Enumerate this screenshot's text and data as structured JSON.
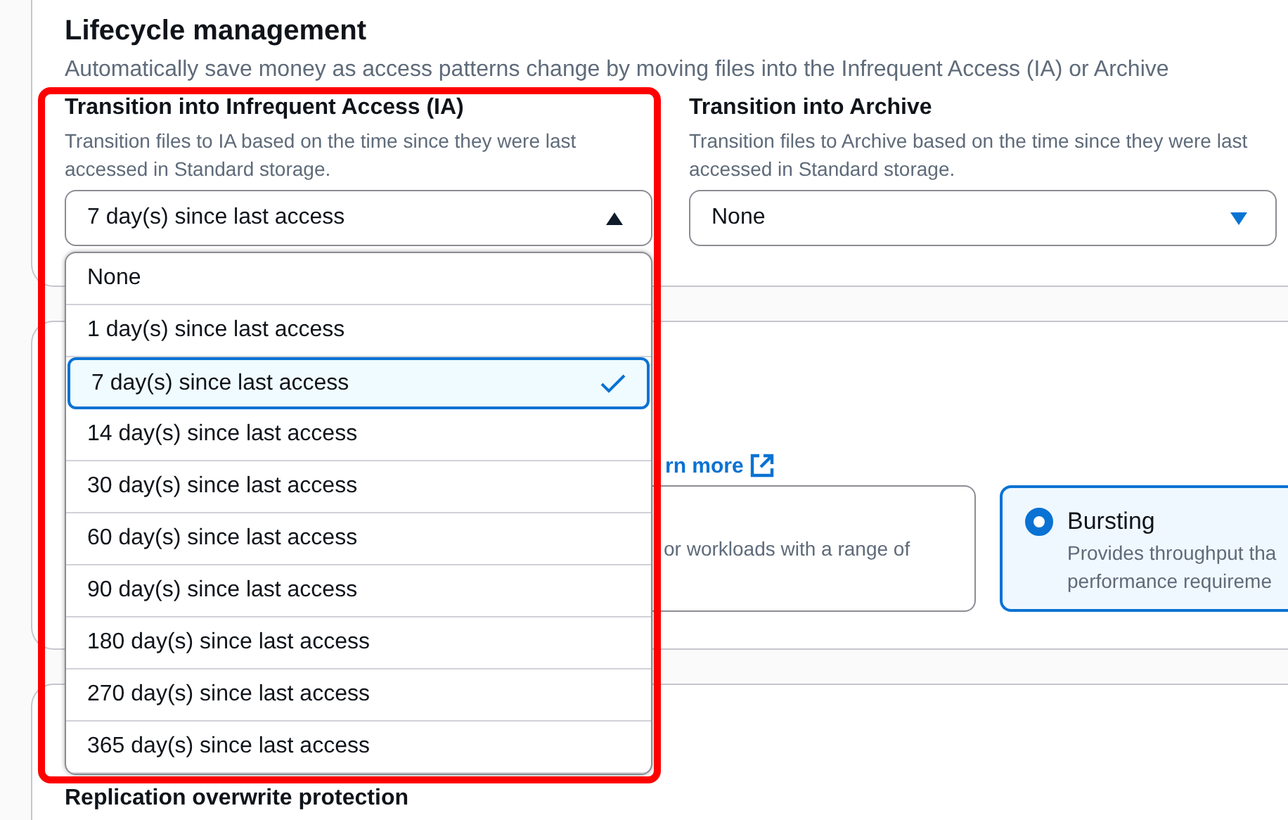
{
  "section": {
    "title": "Lifecycle management",
    "description": "Automatically save money as access patterns change by moving files into the Infrequent Access (IA) or Archive"
  },
  "fields": [
    {
      "label": "Transition into Infrequent Access (IA)",
      "description": "Transition files to IA based on the time since they were last accessed in Standard storage.",
      "value": "7 day(s) since last access",
      "expanded": true
    },
    {
      "label": "Transition into Archive",
      "description": "Transition files to Archive based on the time since they were last accessed in Standard storage.",
      "value": "None",
      "expanded": false
    }
  ],
  "options": [
    {
      "label": "None",
      "selected": false
    },
    {
      "label": "1 day(s) since last access",
      "selected": false
    },
    {
      "label": "7 day(s) since last access",
      "selected": true
    },
    {
      "label": "14 day(s) since last access",
      "selected": false
    },
    {
      "label": "30 day(s) since last access",
      "selected": false
    },
    {
      "label": "60 day(s) since last access",
      "selected": false
    },
    {
      "label": "90 day(s) since last access",
      "selected": false
    },
    {
      "label": "180 day(s) since last access",
      "selected": false
    },
    {
      "label": "270 day(s) since last access",
      "selected": false
    },
    {
      "label": "365 day(s) since last access",
      "selected": false
    }
  ],
  "learn_more": "rn more",
  "tiles": [
    {
      "selected": false,
      "lines": [
        "or workloads with a range of"
      ]
    },
    {
      "title": "Bursting",
      "selected": true,
      "lines": [
        "Provides throughput tha",
        "performance requireme"
      ]
    }
  ],
  "next_section": {
    "title": "Replication overwrite protection"
  }
}
